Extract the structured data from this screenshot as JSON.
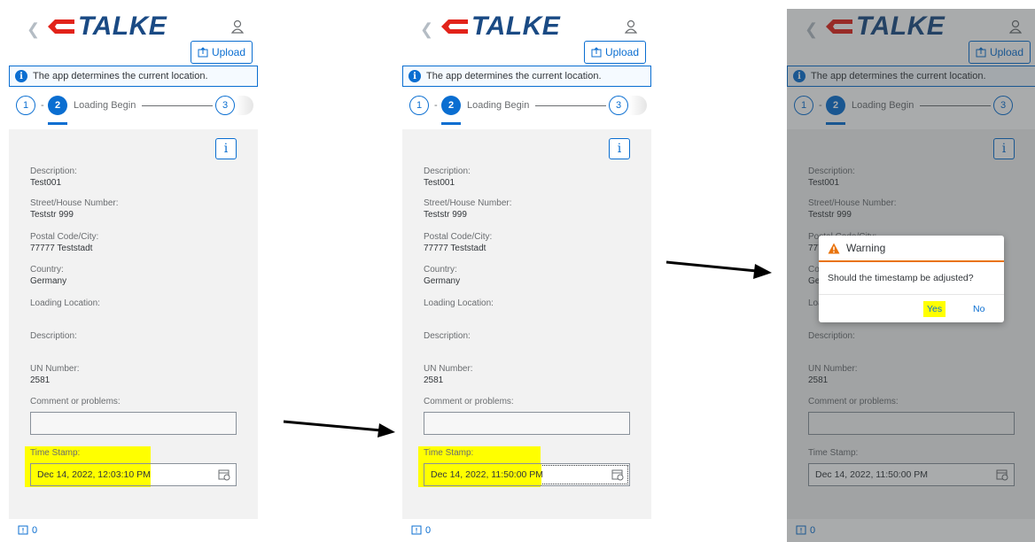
{
  "app": {
    "logo_text": "TALKE",
    "upload_label": "Upload",
    "info_message": "The app determines the current location."
  },
  "stepper": {
    "step1": "1",
    "step2": "2",
    "step2_label": "Loading Begin",
    "step3": "3"
  },
  "fields": {
    "description_label": "Description:",
    "description_value": "Test001",
    "street_label": "Street/House Number:",
    "street_value": "Teststr 999",
    "postal_label": "Postal Code/City:",
    "postal_value": "77777 Teststadt",
    "country_label": "Country:",
    "country_value": "Germany",
    "loading_location_label": "Loading Location:",
    "description2_label": "Description:",
    "un_label": "UN Number:",
    "un_value": "2581",
    "comment_label": "Comment or problems:",
    "timestamp_label": "Time Stamp:"
  },
  "panels": {
    "p1_timestamp": "Dec 14, 2022, 12:03:10 PM",
    "p2_timestamp": "Dec 14, 2022, 11:50:00 PM",
    "p3_timestamp": "Dec 14, 2022, 11:50:00 PM"
  },
  "footer": {
    "message_count": "0"
  },
  "dialog": {
    "title": "Warning",
    "message": "Should the timestamp be adjusted?",
    "yes_label": "Yes",
    "no_label": "No"
  },
  "colors": {
    "accent": "#0a6ed1",
    "logo_red": "#e2231a",
    "logo_blue": "#1a4a84",
    "highlight": "#ffff00",
    "warning": "#e9730c"
  },
  "icons": [
    "back-icon",
    "user-icon",
    "upload-icon",
    "info-icon",
    "calendar-icon",
    "message-icon",
    "warning-icon",
    "arrow-icon"
  ]
}
